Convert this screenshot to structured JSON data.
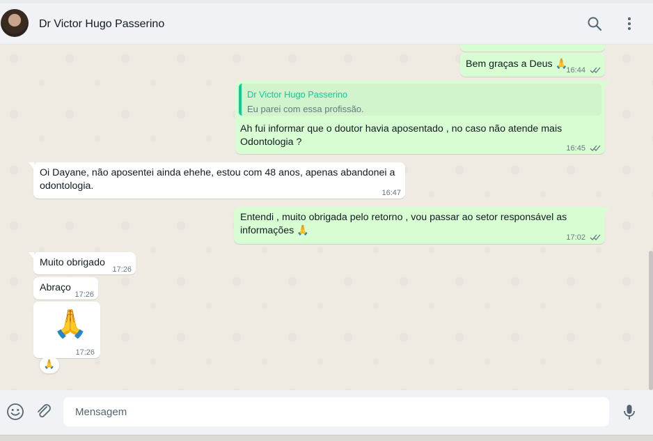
{
  "header": {
    "contact_name": "Dr Victor Hugo Passerino",
    "icons": [
      "search-icon",
      "menu-icon"
    ]
  },
  "messages": [
    {
      "id": "m1",
      "direction": "out",
      "text": "Bem graças a Deus 🙏",
      "time": "16:44",
      "ticks": "read"
    },
    {
      "id": "m2",
      "direction": "out",
      "quote_name": "Dr Victor Hugo Passerino",
      "quote_text": "Eu parei com essa profissão.",
      "text_line1": "Ah fui informar que o doutor havia aposentado , no caso não atende mais",
      "text_line2": "Odontologia ?",
      "time": "16:45",
      "ticks": "read"
    },
    {
      "id": "m3",
      "direction": "in",
      "text_line1": "Oi Dayane, não aposentei ainda ehehe, estou com 48 anos, apenas abandonei a",
      "text_line2": "odontologia.",
      "time": "16:47"
    },
    {
      "id": "m4",
      "direction": "out",
      "text_line1": "Entendi , muito obrigada pelo retorno , vou passar ao setor responsável as",
      "text_line2": "informações 🙏",
      "time": "17:02",
      "ticks": "read"
    },
    {
      "id": "m5",
      "direction": "in",
      "text": "Muito obrigado",
      "time": "17:26"
    },
    {
      "id": "m6",
      "direction": "in",
      "text": "Abraço",
      "time": "17:26"
    },
    {
      "id": "m7",
      "direction": "in",
      "emoji": "🙏",
      "time": "17:26",
      "reaction": "🙏"
    }
  ],
  "composer": {
    "placeholder": "Mensagem",
    "icons": [
      "emoji-icon",
      "attach-icon",
      "mic-icon"
    ]
  },
  "colors": {
    "outgoing_bubble": "#d9fdd3",
    "incoming_bubble": "#ffffff",
    "quote_accent": "#06cf9c",
    "read_ticks": "#667781"
  }
}
